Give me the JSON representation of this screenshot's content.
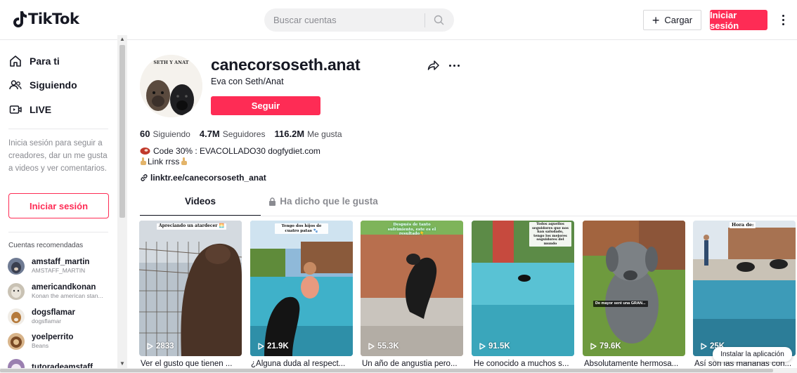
{
  "header": {
    "logo_text": "TikTok",
    "search_placeholder": "Buscar cuentas",
    "upload_label": "Cargar",
    "login_label": "Iniciar sesión"
  },
  "sidebar": {
    "nav": [
      {
        "label": "Para ti",
        "icon": "home-icon"
      },
      {
        "label": "Siguiendo",
        "icon": "following-icon"
      },
      {
        "label": "LIVE",
        "icon": "live-icon"
      }
    ],
    "hint": "Inicia sesión para seguir a creadores, dar un me gusta a videos y ver comentarios.",
    "login_label": "Iniciar sesión",
    "recommended_heading": "Cuentas recomendadas",
    "accounts": [
      {
        "name": "amstaff_martin",
        "sub": "AMSTAFF_MARTIN"
      },
      {
        "name": "americandkonan",
        "sub": "Konan the american stan..."
      },
      {
        "name": "dogsflamar",
        "sub": "dogsflamar"
      },
      {
        "name": "yoelperrito",
        "sub": "Beans"
      },
      {
        "name": "tutoradeamstaff",
        "sub": ""
      }
    ]
  },
  "profile": {
    "avatar_text": "SETH Y ANAT",
    "username": "canecorsoseth.anat",
    "nickname": "Eva con Seth/Anat",
    "follow_label": "Seguir",
    "stats": {
      "following_count": "60",
      "following_label": "Siguiendo",
      "followers_count": "4.7M",
      "followers_label": "Seguidores",
      "likes_count": "116.2M",
      "likes_label": "Me gusta"
    },
    "bio": {
      "line1": "Code 30% : EVACOLLADO30 dogfydiet.com",
      "line2": "Link rrss",
      "link": "linktr.ee/canecorsoseth_anat"
    }
  },
  "tabs": {
    "videos": "Videos",
    "liked": "Ha dicho que le gusta"
  },
  "videos": [
    {
      "views": "2833",
      "caption": "Ver el gusto que tienen ...",
      "overlay": "Apreciando un atardecer 🌅"
    },
    {
      "views": "21.9K",
      "caption": "¿Alguna duda al respect...",
      "overlay": "Tengo dos hijos de cuatro patas 🐾"
    },
    {
      "views": "55.3K",
      "caption": "Un año de angustia pero...",
      "overlay": "Después de tanto sufrimiento, este es el resultado👇"
    },
    {
      "views": "91.5K",
      "caption": "He conocido a muchos s...",
      "overlay": "Todos aquellos seguidores que nos han saludado, tengo los mejores seguidores del mundo"
    },
    {
      "views": "79.6K",
      "caption": "Absolutamente hermosa...",
      "overlay": "De mayor seré una GRAN..."
    },
    {
      "views": "25K",
      "caption": "Así son las mañanas con...",
      "overlay": "Hora de:"
    }
  ],
  "install_app_label": "Instalar la aplicación",
  "colors": {
    "accent": "#fe2c55",
    "text": "#161823",
    "muted": "#8a8b91"
  }
}
